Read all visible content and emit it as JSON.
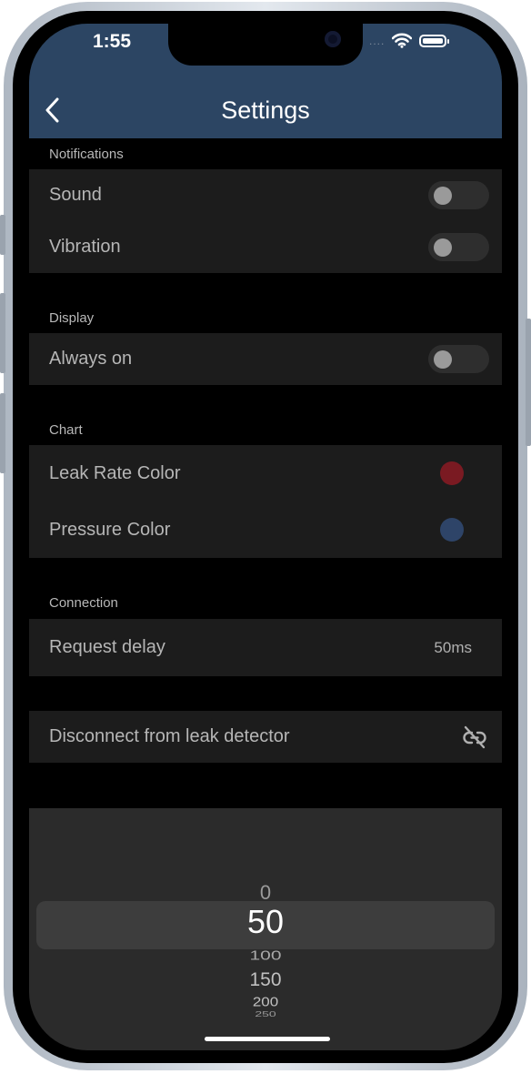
{
  "status_bar": {
    "time": "1:55",
    "signal_dots": "....",
    "icons": [
      "wifi-icon",
      "battery-icon"
    ]
  },
  "header": {
    "title": "Settings",
    "back_icon": "chevron-left-icon"
  },
  "sections": {
    "notifications": {
      "label": "Notifications",
      "sound": "Sound",
      "vibration": "Vibration"
    },
    "display": {
      "label": "Display",
      "always_on": "Always on"
    },
    "chart": {
      "label": "Chart",
      "leak_rate_color": "Leak Rate Color",
      "pressure_color": "Pressure Color"
    },
    "connection": {
      "label": "Connection",
      "request_delay": "Request delay",
      "request_delay_value": "50ms"
    },
    "disconnect": {
      "label": "Disconnect from leak detector",
      "icon": "link-off-icon"
    }
  },
  "toggles": {
    "sound": false,
    "vibration": false,
    "always_on": false
  },
  "colors": {
    "header": "#2c4563",
    "leak_rate": "#7a1a22",
    "pressure": "#2e4468",
    "background": "#000000",
    "cell": "#1c1c1c"
  },
  "picker": {
    "options": [
      "0",
      "50",
      "100",
      "150",
      "200",
      "250"
    ],
    "selected": "50"
  }
}
